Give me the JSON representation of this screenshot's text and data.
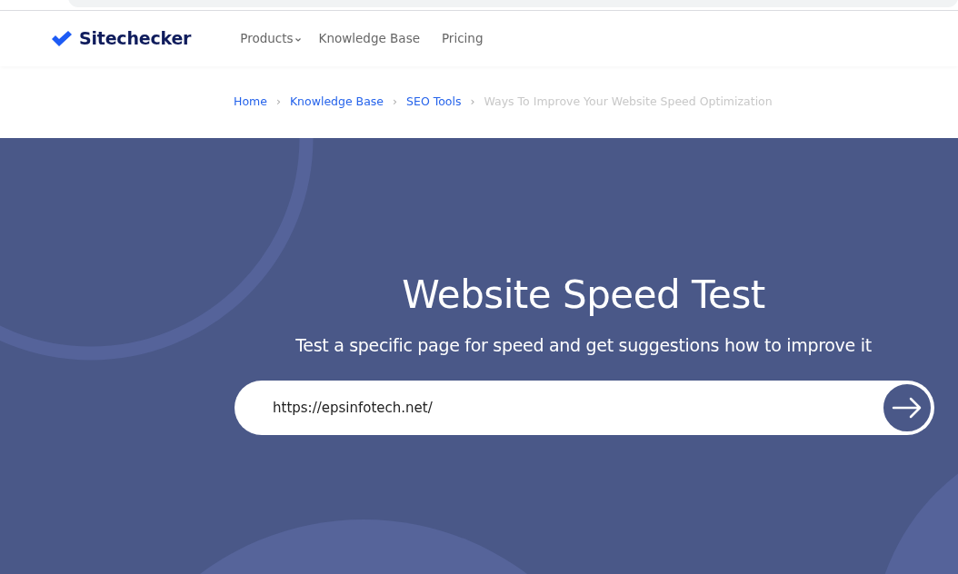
{
  "header": {
    "logo": "Sitechecker",
    "nav": [
      {
        "label": "Products",
        "kind": "dropdown"
      },
      {
        "label": "Knowledge Base",
        "kind": "link"
      },
      {
        "label": "Pricing",
        "kind": "link"
      }
    ]
  },
  "breadcrumb": {
    "items": [
      {
        "label": "Home",
        "current": false
      },
      {
        "label": "Knowledge Base",
        "current": false
      },
      {
        "label": "SEO Tools",
        "current": false
      },
      {
        "label": "Ways To Improve Your Website Speed Optimization",
        "current": true
      }
    ],
    "separator": "›"
  },
  "hero": {
    "title": "Website Speed Test",
    "subtitle": "Test a specific page for speed and get suggestions how to improve it",
    "url_field": {
      "value": "https://epsinfotech.net/"
    }
  }
}
